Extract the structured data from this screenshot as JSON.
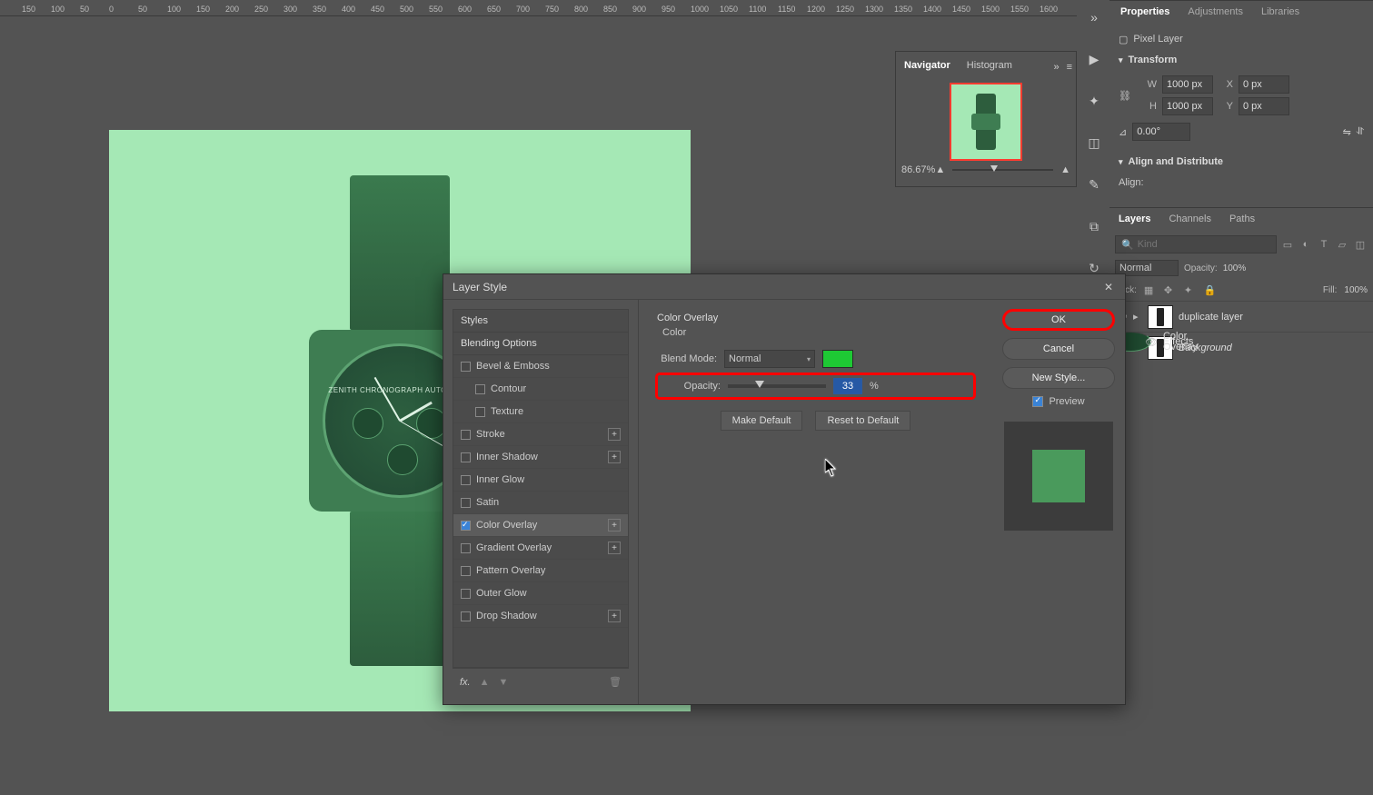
{
  "ruler": {
    "start": -150,
    "end": 1600,
    "step": 50
  },
  "navigator": {
    "tabs": [
      "Navigator",
      "Histogram"
    ],
    "zoom": "86.67%"
  },
  "properties": {
    "tabs": [
      "Properties",
      "Adjustments",
      "Libraries"
    ],
    "kind": "Pixel Layer",
    "transform": {
      "title": "Transform",
      "W": "1000 px",
      "X": "0 px",
      "H": "1000 px",
      "Y": "0 px",
      "angle": "0.00°"
    },
    "align_title": "Align and Distribute",
    "align_label": "Align:"
  },
  "layers_panel": {
    "tabs": [
      "Layers",
      "Channels",
      "Paths"
    ],
    "search_placeholder": "Kind",
    "blend_mode": "Normal",
    "opacity_label": "Opacity:",
    "opacity_val": "100%",
    "fill_label": "Fill:",
    "fill_val": "100%",
    "layers": [
      {
        "name": "duplicate layer",
        "effects": [
          "Effects",
          "Color Overlay"
        ]
      },
      {
        "name": "Background",
        "italic": true
      }
    ]
  },
  "dialog": {
    "title": "Layer Style",
    "styles_label": "Styles",
    "blending_label": "Blending Options",
    "effects": [
      {
        "name": "Bevel & Emboss",
        "on": false,
        "add": false
      },
      {
        "name": "Contour",
        "on": false,
        "indent": true
      },
      {
        "name": "Texture",
        "on": false,
        "indent": true
      },
      {
        "name": "Stroke",
        "on": false,
        "add": true
      },
      {
        "name": "Inner Shadow",
        "on": false,
        "add": true
      },
      {
        "name": "Inner Glow",
        "on": false
      },
      {
        "name": "Satin",
        "on": false
      },
      {
        "name": "Color Overlay",
        "on": true,
        "sel": true,
        "add": true
      },
      {
        "name": "Gradient Overlay",
        "on": false,
        "add": true
      },
      {
        "name": "Pattern Overlay",
        "on": false
      },
      {
        "name": "Outer Glow",
        "on": false
      },
      {
        "name": "Drop Shadow",
        "on": false,
        "add": true
      }
    ],
    "section": "Color Overlay",
    "sub": "Color",
    "blend_label": "Blend Mode:",
    "blend_value": "Normal",
    "overlay_color": "#1ec934",
    "opacity_label": "Opacity:",
    "opacity_value": "33",
    "opacity_unit": "%",
    "make_default": "Make Default",
    "reset_default": "Reset to Default",
    "buttons": {
      "ok": "OK",
      "cancel": "Cancel",
      "new_style": "New Style...",
      "preview": "Preview"
    }
  },
  "dial_text": "ZENITH\nCHRONOGRAPH\nAUTOMATIC"
}
